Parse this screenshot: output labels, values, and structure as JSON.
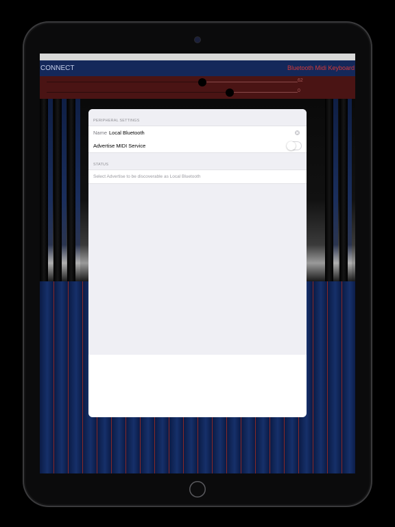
{
  "navbar": {
    "connect_label": "CONNECT",
    "title": "Bluetooth Midi Keyboard"
  },
  "controls": {
    "slider1": {
      "value_label": "62",
      "fraction": 0.62
    },
    "slider2": {
      "value_label": "0",
      "fraction": 0.73
    }
  },
  "modal": {
    "peripheral_header": "PERIPHERAL SETTINGS",
    "name_label": "Name",
    "name_value": "Local Bluetooth",
    "advertise_label": "Advertise MIDI Service",
    "advertise_on": false,
    "status_header": "STATUS",
    "status_text": "Select Advertise to be discoverable as Local Bluetooth"
  },
  "colors": {
    "nav_background": "#14285a",
    "title_red": "#d63a3a",
    "controls_background": "#4a1414",
    "modal_background": "#efeff4"
  },
  "icons": {
    "clear": "clear-icon",
    "camera": "camera-icon",
    "home": "home-button-icon"
  }
}
